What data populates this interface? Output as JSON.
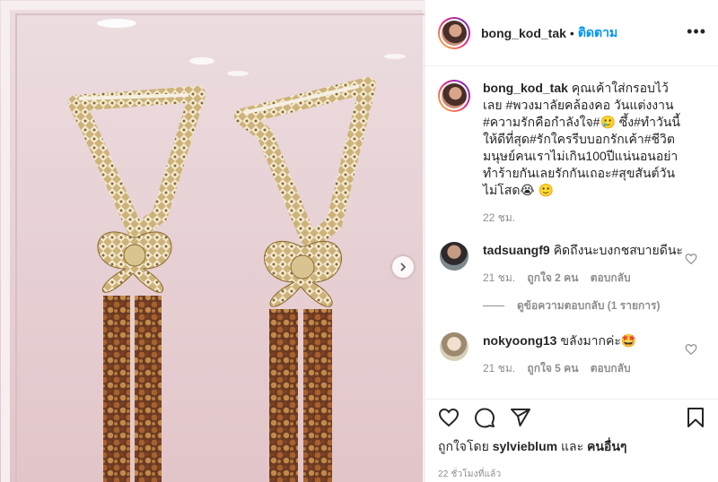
{
  "header": {
    "username": "bong_kod_tak",
    "separator": "•",
    "follow_label": "ติดตาม",
    "more_label": "•••"
  },
  "caption": {
    "username": "bong_kod_tak",
    "text": "คุณเค้าใส่กรอบไว้เลย #พวงมาลัยคล้องคอ วันแต่งงาน #ความรักคือกำลังใจ#🥲 ซึ้ง#ทำวันนี้ให้ดีที่สุด#รักใครรีบบอกรักเค้า#ชีวิตมนุษย์คนเราไม่เกิน100ปีแน่นอนอย่าทำร้ายกันเลยรักกันเถอะ#สุขสันต์วันไม่โสด😭 🙂",
    "time": "22 ชม."
  },
  "comments": [
    {
      "username": "tadsuangf9",
      "text": "คิดถึงนะบงกชสบายดีนะ",
      "time": "21 ชม.",
      "likes": "ถูกใจ 2 คน",
      "reply_label": "ตอบกลับ",
      "view_replies": "ดูข้อความตอบกลับ (1 รายการ)"
    },
    {
      "username": "nokyoong13",
      "text": "ขลังมากค่ะ🤩",
      "time": "21 ชม.",
      "likes": "ถูกใจ 5 คน",
      "reply_label": "ตอบกลับ"
    }
  ],
  "actions": {
    "liked_by_prefix": "ถูกใจโดย",
    "liked_by_user": "sylvieblum",
    "liked_by_and": "และ",
    "liked_by_others": "คนอื่นๆ",
    "timestamp": "22 ชั่วโมงที่แล้ว"
  },
  "icons": {
    "like": "heart-icon",
    "comment": "comment-icon",
    "share": "share-icon",
    "save": "bookmark-icon",
    "next": "chevron-right-icon"
  },
  "colors": {
    "link": "#0095f6",
    "text": "#262626",
    "muted": "#8e8e8e",
    "wall": "#e9d3d6"
  }
}
